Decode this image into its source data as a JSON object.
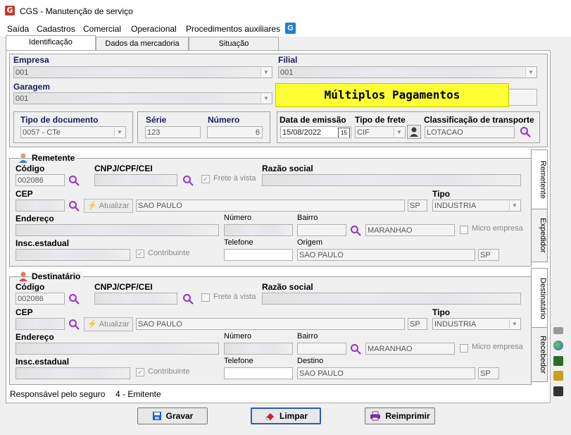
{
  "window": {
    "title": "CGS - Manutenção de serviço"
  },
  "menu": [
    "Saída",
    "Cadastros",
    "Comercial",
    "Operacional",
    "Procedimentos auxiliares"
  ],
  "tabs": [
    "Identificação",
    "Dados da mercadoria",
    "Situação"
  ],
  "empresa": {
    "label": "Empresa",
    "code": "001"
  },
  "filial": {
    "label": "Filial",
    "code": "001"
  },
  "garagem": {
    "label": "Garagem",
    "code": "001"
  },
  "banner": "Múltiplos Pagamentos",
  "doc": {
    "tipo_label": "Tipo de documento",
    "tipo_value": "0057 - CTe",
    "serie_label": "Série",
    "serie_value": "123",
    "numero_label": "Número",
    "numero_value": "6"
  },
  "emissao": {
    "data_label": "Data de emissão",
    "data_value": "15/08/2022",
    "frete_label": "Tipo de frete",
    "frete_value": "CIF",
    "class_label": "Classificação de transporte",
    "class_value": "LOTACAO"
  },
  "remetente": {
    "title": "Remetente",
    "codigo_label": "Código",
    "codigo_value": "002086",
    "cnpj_label": "CNPJ/CPF/CEI",
    "frete_vista": "Frete à vista",
    "razao_label": "Razão social",
    "cep_label": "CEP",
    "atualizar": "Atualizar",
    "cidade": "SAO PAULO",
    "uf": "SP",
    "tipo_label": "Tipo",
    "tipo_value": "INDUSTRIA",
    "endereco_label": "Endereço",
    "numero_label": "Número",
    "bairro_label": "Bairro",
    "bairro_value": "MARANHAO",
    "micro": "Micro empresa",
    "ie_label": "Insc.estadual",
    "contribuinte": "Contribuinte",
    "telefone_label": "Telefone",
    "origem_label": "Origem",
    "origem_value": "SAO PAULO",
    "origem_uf": "SP"
  },
  "destinatario": {
    "title": "Destinatário",
    "codigo_label": "Código",
    "codigo_value": "002086",
    "cnpj_label": "CNPJ/CPF/CEI",
    "frete_vista": "Frete à vista",
    "razao_label": "Razão social",
    "cep_label": "CEP",
    "atualizar": "Atualizar",
    "cidade": "SAO PAULO",
    "uf": "SP",
    "tipo_label": "Tipo",
    "tipo_value": "INDUSTRIA",
    "endereco_label": "Endereço",
    "numero_label": "Número",
    "bairro_label": "Bairro",
    "bairro_value": "MARANHAO",
    "micro": "Micro empresa",
    "ie_label": "Insc.estadual",
    "contribuinte": "Contribuinte",
    "telefone_label": "Telefone",
    "destino_label": "Destino",
    "destino_value": "SAO PAULO",
    "destino_uf": "SP"
  },
  "side_tabs": [
    "Remetente",
    "Expedidor",
    "Destinatário",
    "Recebedor"
  ],
  "seguro": {
    "label": "Responsável pelo seguro",
    "value": "4 - Emitente"
  },
  "buttons": {
    "gravar": "Gravar",
    "limpar": "Limpar",
    "reimprimir": "Reimprimir"
  },
  "colors": {
    "accent": "#1a1a66",
    "banner": "#ffff33",
    "magnifier": "#9b30d0"
  },
  "icons": {
    "app": "cgs-logo-icon",
    "search": "magnifier-icon",
    "person": "person-icon"
  }
}
